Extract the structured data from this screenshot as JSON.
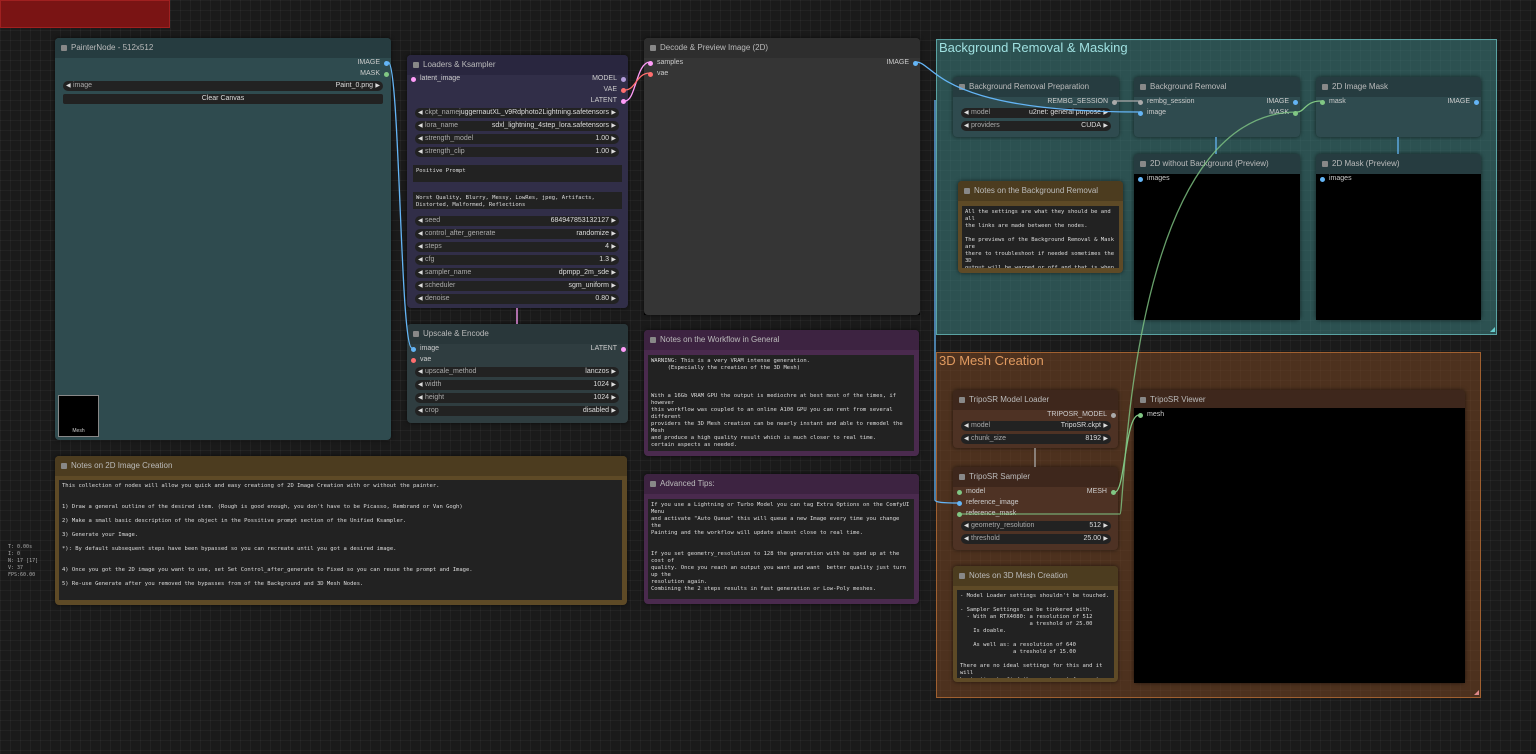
{
  "stats": [
    "T: 0.00s",
    "I: 0",
    "N: 17 [17]",
    "V: 37",
    "FPS:60.00"
  ],
  "groups": {
    "background": "Background Removal & Masking",
    "mesh": "3D Mesh Creation"
  },
  "painter": {
    "title": "PainterNode - 512x512",
    "out_image": "IMAGE",
    "out_mask": "MASK",
    "image_label": "image",
    "image_value": "Paint_0.png",
    "clear_button": "Clear Canvas",
    "thumb_label": "Mesh"
  },
  "loaders": {
    "title": "Loaders & Ksampler",
    "in_latent": "latent_image",
    "out_model": "MODEL",
    "out_vae": "VAE",
    "out_latent": "LATENT",
    "widgets": [
      {
        "label": "ckpt_name",
        "value": "juggernautXL_v9Rdphoto2Lightning.safetensors"
      },
      {
        "label": "lora_name",
        "value": "sdxl_lightning_4step_lora.safetensors"
      },
      {
        "label": "strength_model",
        "value": "1.00"
      },
      {
        "label": "strength_clip",
        "value": "1.00"
      }
    ],
    "positive": "Positive Prompt",
    "negative": "Worst Quality, Blurry, Messy, LowRes, jpeg, Artifacts, Distorted, Malformed, Reflections",
    "widgets2": [
      {
        "label": "seed",
        "value": "684947853132127"
      },
      {
        "label": "control_after_generate",
        "value": "randomize"
      },
      {
        "label": "steps",
        "value": "4"
      },
      {
        "label": "cfg",
        "value": "1.3"
      },
      {
        "label": "sampler_name",
        "value": "dpmpp_2m_sde"
      },
      {
        "label": "scheduler",
        "value": "sgm_uniform"
      },
      {
        "label": "denoise",
        "value": "0.80"
      }
    ]
  },
  "upscale": {
    "title": "Upscale & Encode",
    "in_image": "image",
    "in_vae": "vae",
    "out_latent": "LATENT",
    "widgets": [
      {
        "label": "upscale_method",
        "value": "lanczos"
      },
      {
        "label": "width",
        "value": "1024"
      },
      {
        "label": "height",
        "value": "1024"
      },
      {
        "label": "crop",
        "value": "disabled"
      }
    ]
  },
  "decode": {
    "title": "Decode & Preview Image (2D)",
    "in_samples": "samples",
    "in_vae": "vae",
    "out_image": "IMAGE"
  },
  "notes_workflow": {
    "title": "Notes on the Workflow in General",
    "text": "WARNING: This is a very VRAM intense generation.\n     (Especially the creation of the 3D Mesh)\n\n\n\nWith a 16Gb VRAM GPU the output is mediochre at best most of the times, if however\nthis workflow was coupled to an online A100 GPU you can rent from several different\nproviders the 3D Mesh creation can be nearly instant and able to remodel the Mesh\nand produce a high quality result which is much closer to real time.\ncertain aspects as needed."
  },
  "advanced": {
    "title": "Advanced Tips:",
    "text": "If you use a Lightning or Turbo Model you can tag Extra Options on the ComfyUI Menu\nand activate \"Auto Queue\" this will queue a new Image every time you change the\nPainting and the workflow will update almost close to real time.\n\n\nIf you set geometry_resolution to 128 the generation with be sped up at the cost of\nquality. Once you reach an output you want and want  better quality just turn up the\nresolution again.\nCombining the 2 steps results in fast generation or Low-Poly meshes."
  },
  "notes_2d": {
    "title": "Notes on 2D Image Creation",
    "text": "This collection of nodes will allow you quick and easy creationg of 2D Image Creation with or without the painter.\n\n\n1) Draw a general outline of the desired item. (Rough is good enough, you don't have to be Picasso, Rembrand or Van Gogh)\n\n2) Make a small basic description of the object in the Possitive prompt section of the Unified Ksampler.\n\n3) Generate your Image.\n\n*): By default subsequent steps have been bypassed so you can recreate until you got a desired image.\n\n\n4) Once you got the 2D image you want to use, set Set Control_after_generate to Fixed so you can reuse the prompt and Image.\n\n5) Re-use Generate after you removed the bypasses from of the Background and 3D Mesh Nodes."
  },
  "bg_prep": {
    "title": "Background Removal Preparation",
    "out": "REMBG_SESSION",
    "widgets": [
      {
        "label": "model",
        "value": "u2net: general purpose"
      },
      {
        "label": "providers",
        "value": "CUDA"
      }
    ]
  },
  "bg_remove": {
    "title": "Background Removal",
    "in_session": "rembg_session",
    "in_image": "image",
    "out_image": "IMAGE",
    "out_mask": "MASK"
  },
  "mask2d": {
    "title": "2D Image Mask",
    "in_mask": "mask",
    "out_image": "IMAGE"
  },
  "preview_nobg": {
    "title": "2D without Background (Preview)",
    "in": "images"
  },
  "preview_mask": {
    "title": "2D Mask (Preview)",
    "in": "images"
  },
  "notes_bg": {
    "title": "Notes on the Background Removal",
    "text": "All the settings are what they should be and all\nthe links are made between the nodes.\n\nThe previews of the Background Removal & Mask are\nthere to troubleshoot if needed sometimes the 3D\noutput will be warped or off and that is when you\ncan check if something went wrong here or not."
  },
  "tripo_loader": {
    "title": "TripoSR Model Loader",
    "out": "TRIPOSR_MODEL",
    "widgets": [
      {
        "label": "model",
        "value": "TripoSR.ckpt"
      },
      {
        "label": "chunk_size",
        "value": "8192"
      }
    ]
  },
  "tripo_sampler": {
    "title": "TripoSR Sampler",
    "in_model": "model",
    "in_ref": "reference_image",
    "in_mask": "reference_mask",
    "out_mesh": "MESH",
    "widgets": [
      {
        "label": "geometry_resolution",
        "value": "512"
      },
      {
        "label": "threshold",
        "value": "25.00"
      }
    ]
  },
  "tripo_viewer": {
    "title": "TripoSR Viewer",
    "in": "mesh"
  },
  "notes_3d": {
    "title": "Notes on 3D Mesh Creation",
    "text": "- Model Loader settings shouldn't be touched.\n\n- Sampler Settings can be tinkered with.\n  - With an RTX4080: a resolution of 512\n                     a treshold of 25.00\n    Is doable.\n\n    As well as: a resolution of 640\n                a treshold of 15.00\n\nThere are no ideal settings for this and it will\nbe testing to find the sweet spot for most\ngenerations."
  },
  "colors": {
    "image_slot": "#64b5f6",
    "mask_slot": "#81c784",
    "latent_slot": "#ff9cf9",
    "vae_slot": "#ff6e6e",
    "model_slot": "#b39ddb"
  }
}
